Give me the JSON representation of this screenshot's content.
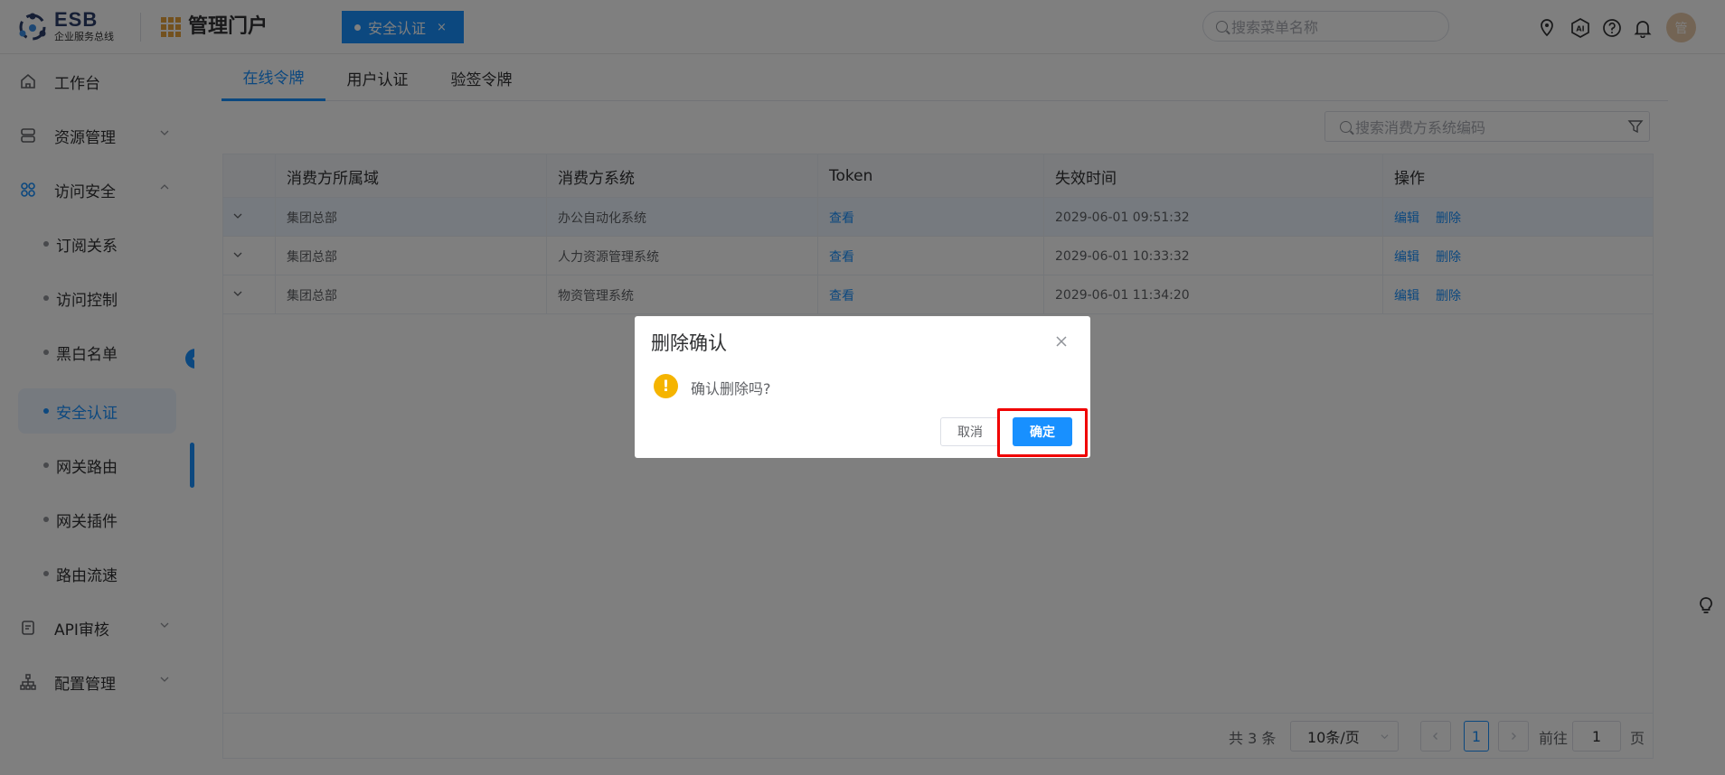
{
  "header": {
    "logo_title": "ESB",
    "logo_subtitle": "企业服务总线",
    "portal_title": "管理门户",
    "active_tab": {
      "label": "安全认证",
      "close": "×"
    },
    "menu_search_placeholder": "搜索菜单名称",
    "icons": [
      "location-icon",
      "ai-icon",
      "help-icon",
      "bell-icon"
    ],
    "avatar_text": "管"
  },
  "sidebar": {
    "items": [
      {
        "label": "工作台",
        "icon": "home-icon"
      },
      {
        "label": "资源管理",
        "icon": "database-icon",
        "expanded": false
      },
      {
        "label": "访问安全",
        "icon": "grid-apps-icon",
        "expanded": true
      }
    ],
    "sub_items": [
      {
        "label": "订阅关系"
      },
      {
        "label": "访问控制"
      },
      {
        "label": "黑白名单"
      },
      {
        "label": "安全认证",
        "active": true
      },
      {
        "label": "网关路由"
      },
      {
        "label": "网关插件"
      },
      {
        "label": "路由流速"
      }
    ],
    "bottom_items": [
      {
        "label": "API审核",
        "icon": "document-check-icon"
      },
      {
        "label": "配置管理",
        "icon": "org-chart-icon"
      }
    ]
  },
  "main": {
    "tabs": [
      {
        "label": "在线令牌",
        "active": true
      },
      {
        "label": "用户认证"
      },
      {
        "label": "验签令牌"
      }
    ],
    "filter_placeholder": "搜索消费方系统编码",
    "table": {
      "columns": [
        "消费方所属域",
        "消费方系统",
        "Token",
        "失效时间",
        "操作"
      ],
      "rows": [
        {
          "domain": "集团总部",
          "system": "办公自动化系统",
          "token": "查看",
          "expire": "2029-06-01 09:51:32",
          "edit": "编辑",
          "delete": "删除"
        },
        {
          "domain": "集团总部",
          "system": "人力资源管理系统",
          "token": "查看",
          "expire": "2029-06-01 10:33:32",
          "edit": "编辑",
          "delete": "删除"
        },
        {
          "domain": "集团总部",
          "system": "物资管理系统",
          "token": "查看",
          "expire": "2029-06-01 11:34:20",
          "edit": "编辑",
          "delete": "删除"
        }
      ]
    },
    "pagination": {
      "total": "共 3 条",
      "page_size": "10条/页",
      "current_page": "1",
      "goto_label": "前往",
      "goto_value": "1",
      "page_suffix": "页"
    }
  },
  "dialog": {
    "title": "删除确认",
    "message": "确认删除吗?",
    "cancel_label": "取消",
    "confirm_label": "确定",
    "warn_glyph": "!"
  },
  "colors": {
    "primary": "#1890ff",
    "warning": "#f5b400",
    "highlight": "#f00000"
  }
}
